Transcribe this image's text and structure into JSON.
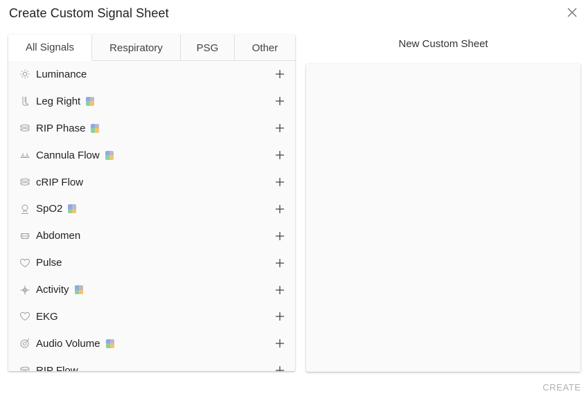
{
  "dialog": {
    "title": "Create Custom Signal Sheet",
    "close_icon": "close-icon",
    "create_label": "CREATE",
    "create_enabled": false
  },
  "tabs": [
    {
      "label": "All Signals",
      "active": true
    },
    {
      "label": "Respiratory",
      "active": false
    },
    {
      "label": "PSG",
      "active": false
    },
    {
      "label": "Other",
      "active": false
    }
  ],
  "signals": [
    {
      "label": "Luminance",
      "icon": "sun-icon",
      "chip": false
    },
    {
      "label": "Leg Right",
      "icon": "leg-icon",
      "chip": true
    },
    {
      "label": "RIP Phase",
      "icon": "rip-band-icon",
      "chip": true
    },
    {
      "label": "Cannula Flow",
      "icon": "cannula-icon",
      "chip": true
    },
    {
      "label": "cRIP Flow",
      "icon": "rip-band-icon",
      "chip": false
    },
    {
      "label": "SpO2",
      "icon": "oximeter-icon",
      "chip": true
    },
    {
      "label": "Abdomen",
      "icon": "abdomen-icon",
      "chip": false
    },
    {
      "label": "Pulse",
      "icon": "heart-icon",
      "chip": false
    },
    {
      "label": "Activity",
      "icon": "activity-icon",
      "chip": true
    },
    {
      "label": "EKG",
      "icon": "heart-icon",
      "chip": false
    },
    {
      "label": "Audio Volume",
      "icon": "audio-icon",
      "chip": true
    },
    {
      "label": "RIP Flow",
      "icon": "rip-band-icon",
      "chip": false
    }
  ],
  "sheet": {
    "title": "New Custom Sheet"
  },
  "colors": {
    "chip_blue": "#8fa9e6",
    "chip_green": "#8fd19e",
    "chip_orange": "#f2c46d",
    "chip_gray": "#b9b9c9",
    "icon_gray": "#9e9e9e",
    "text": "#212121"
  }
}
